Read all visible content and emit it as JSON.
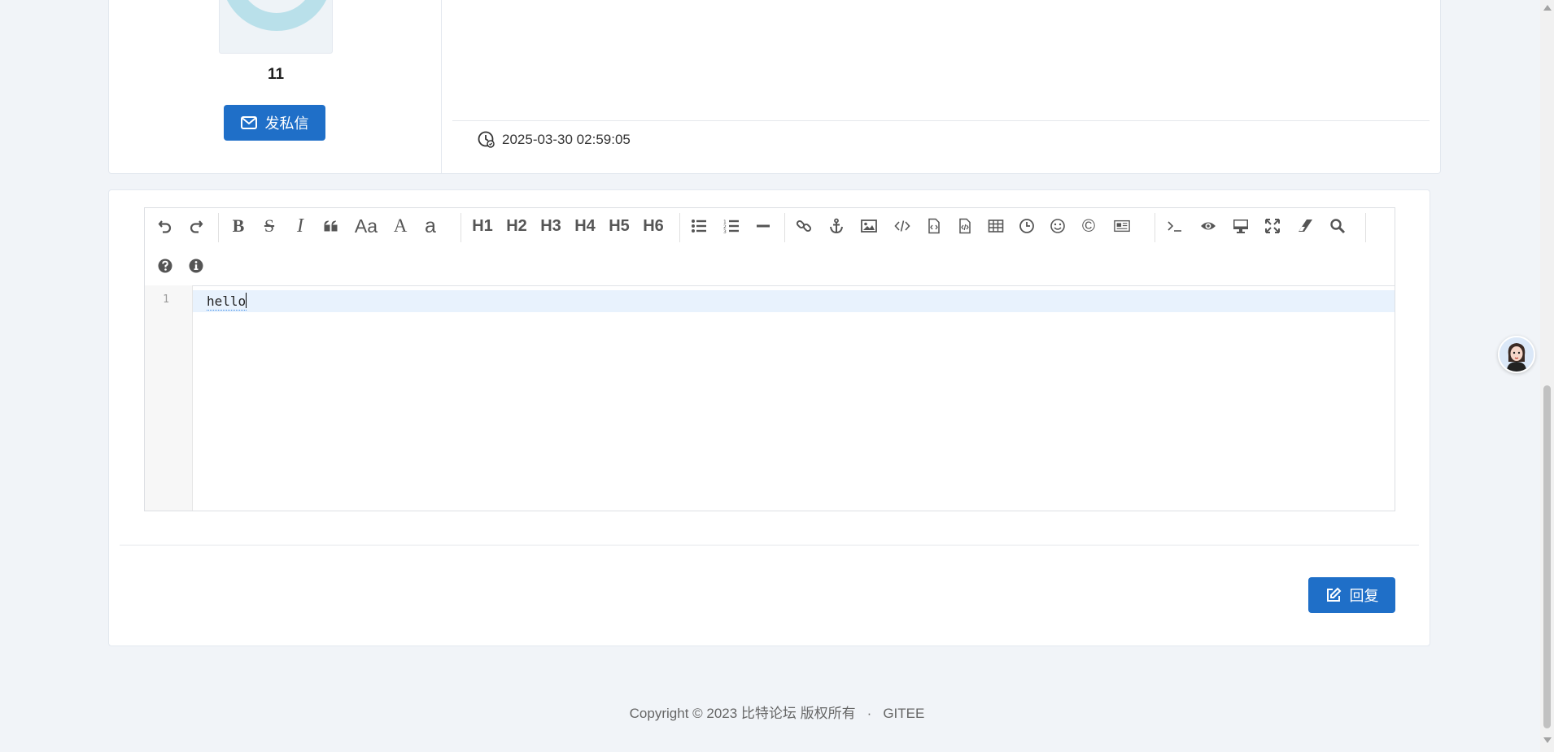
{
  "user": {
    "username": "11",
    "pm_button_label": "发私信"
  },
  "post": {
    "timestamp": "2025-03-30 02:59:05"
  },
  "editor": {
    "toolbar": {
      "tools": [
        {
          "name": "undo",
          "glyph": ""
        },
        {
          "name": "redo",
          "glyph": ""
        },
        {
          "name": "bold",
          "glyph": "B"
        },
        {
          "name": "strikethrough",
          "glyph": "S"
        },
        {
          "name": "italic",
          "glyph": "I"
        },
        {
          "name": "quote",
          "glyph": ""
        },
        {
          "name": "uppercase",
          "glyph": "Aa"
        },
        {
          "name": "capitalize",
          "glyph": "A"
        },
        {
          "name": "lowercase",
          "glyph": "a"
        },
        {
          "name": "h1",
          "glyph": "H1"
        },
        {
          "name": "h2",
          "glyph": "H2"
        },
        {
          "name": "h3",
          "glyph": "H3"
        },
        {
          "name": "h4",
          "glyph": "H4"
        },
        {
          "name": "h5",
          "glyph": "H5"
        },
        {
          "name": "h6",
          "glyph": "H6"
        },
        {
          "name": "list-ul",
          "glyph": ""
        },
        {
          "name": "list-ol",
          "glyph": ""
        },
        {
          "name": "hr",
          "glyph": ""
        },
        {
          "name": "link",
          "glyph": ""
        },
        {
          "name": "anchor",
          "glyph": ""
        },
        {
          "name": "image",
          "glyph": ""
        },
        {
          "name": "code",
          "glyph": ""
        },
        {
          "name": "preformatted-text",
          "glyph": ""
        },
        {
          "name": "code-block",
          "glyph": ""
        },
        {
          "name": "table",
          "glyph": ""
        },
        {
          "name": "datetime",
          "glyph": ""
        },
        {
          "name": "emoji",
          "glyph": ""
        },
        {
          "name": "html-entities",
          "glyph": "©"
        },
        {
          "name": "pagebreak",
          "glyph": ""
        },
        {
          "name": "goto-line",
          "glyph": ""
        },
        {
          "name": "watch",
          "glyph": ""
        },
        {
          "name": "preview",
          "glyph": ""
        },
        {
          "name": "fullscreen",
          "glyph": ""
        },
        {
          "name": "clear",
          "glyph": ""
        },
        {
          "name": "search",
          "glyph": ""
        },
        {
          "name": "help",
          "glyph": ""
        },
        {
          "name": "info",
          "glyph": ""
        }
      ]
    },
    "line_number": "1",
    "content": "hello"
  },
  "reply_button_label": "回复",
  "footer": {
    "copyright": "Copyright © 2023 比特论坛 版权所有",
    "separator": "·",
    "link": "GITEE"
  },
  "colors": {
    "primary": "#1f6fc8",
    "background": "#f1f4f8",
    "avatar_ring": "#b9e0ea"
  }
}
